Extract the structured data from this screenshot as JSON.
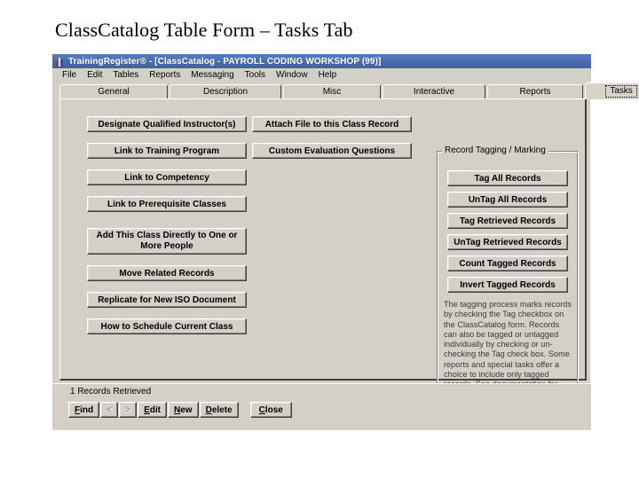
{
  "slide": {
    "title": "ClassCatalog Table Form – Tasks Tab"
  },
  "window": {
    "titlebar": "TrainingRegister® - [ClassCatalog - PAYROLL CODING WORKSHOP (99)]",
    "icon": "bar-chart-icon",
    "accent_color": "#4a6bb0",
    "face_color": "#d4d0c8"
  },
  "menubar": {
    "items": [
      {
        "label": "File"
      },
      {
        "label": "Edit"
      },
      {
        "label": "Tables"
      },
      {
        "label": "Reports"
      },
      {
        "label": "Messaging"
      },
      {
        "label": "Tools"
      },
      {
        "label": "Window"
      },
      {
        "label": "Help"
      }
    ]
  },
  "tabs": {
    "items": [
      {
        "label": "General",
        "active": false
      },
      {
        "label": "Description",
        "active": false
      },
      {
        "label": "Misc",
        "active": false
      },
      {
        "label": "Interactive",
        "active": false
      },
      {
        "label": "Reports",
        "active": false
      },
      {
        "label": "Tasks",
        "active": true
      }
    ],
    "active_label": "Tasks"
  },
  "tasks_panel": {
    "left_buttons": [
      {
        "label": "Designate Qualified Instructor(s)"
      },
      {
        "label": "Link to Training Program"
      },
      {
        "label": "Link to Competency"
      },
      {
        "label": "Link to Prerequisite Classes"
      },
      {
        "label": "Add This Class Directly to One or More People"
      },
      {
        "label": "Move Related Records"
      },
      {
        "label": "Replicate for New ISO Document"
      },
      {
        "label": "How to Schedule Current Class"
      }
    ],
    "middle_buttons": [
      {
        "label": "Attach File to this Class Record"
      },
      {
        "label": "Custom Evaluation Questions"
      }
    ],
    "tagging_group": {
      "title": "Record Tagging / Marking",
      "buttons": [
        {
          "label": "Tag All Records"
        },
        {
          "label": "UnTag All Records"
        },
        {
          "label": "Tag Retrieved Records"
        },
        {
          "label": "UnTag Retrieved Records"
        },
        {
          "label": "Count Tagged Records"
        },
        {
          "label": "Invert Tagged Records"
        }
      ],
      "note": "The tagging process marks records by checking the Tag checkbox on the ClassCatalog form.  Records can also be tagged or untagged individually by checking or un-checking the Tag check box. Some reports and special tasks offer a choice to include only tagged records.  See documentation for additional details."
    }
  },
  "statusbar": {
    "records_text": "1 Records Retrieved",
    "nav_buttons": [
      {
        "label": "Find",
        "mnemonic": "F",
        "enabled": true
      },
      {
        "label": "<",
        "mnemonic": "",
        "enabled": false
      },
      {
        "label": ">",
        "mnemonic": "",
        "enabled": false
      },
      {
        "label": "Edit",
        "mnemonic": "E",
        "enabled": true
      },
      {
        "label": "New",
        "mnemonic": "N",
        "enabled": true
      },
      {
        "label": "Delete",
        "mnemonic": "D",
        "enabled": true
      }
    ],
    "close_button": {
      "label": "Close",
      "mnemonic": "C"
    }
  }
}
